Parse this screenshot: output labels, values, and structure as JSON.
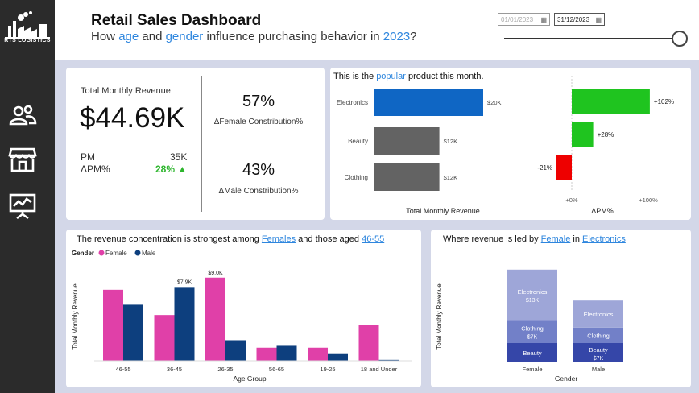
{
  "brand": {
    "logo_text": "RTS LOGISTICS"
  },
  "nav": [
    {
      "icon": "users-icon"
    },
    {
      "icon": "store-icon"
    },
    {
      "icon": "presentation-chart-icon"
    }
  ],
  "header": {
    "title": "Retail Sales Dashboard",
    "subtitle_parts": [
      "How ",
      "age",
      " and ",
      "gender",
      " influence purchasing behavior in ",
      "2023",
      "?"
    ],
    "date_start": "01/01/2023",
    "date_end": "31/12/2023"
  },
  "kpi": {
    "revenue_label": "Total Monthly Revenue",
    "revenue_value": "$44.69K",
    "pm_label": "PM",
    "pm_value": "35K",
    "dpm_label": "ΔPM%",
    "dpm_value": "28% ▲",
    "female_pct": "57%",
    "female_label": "ΔFemale Constribution%",
    "male_pct": "43%",
    "male_label": "ΔMale Constribution%"
  },
  "product": {
    "title_parts": [
      "This is the ",
      "popular",
      " product this month."
    ],
    "xlabel": "Total Monthly Revenue",
    "dpm_xlabel": "ΔPM%",
    "dpm_ticks": [
      "+0%",
      "+100%"
    ]
  },
  "age_card": {
    "title_parts": [
      "The revenue concentration is strongest among ",
      "Females",
      " and those aged ",
      "46-55"
    ],
    "legend_title": "Gender",
    "ylabel": "Total Monthly Revenue",
    "xlabel": "Age Group"
  },
  "gender_card": {
    "title_parts": [
      "Where revenue is led by ",
      "Female",
      " in ",
      "Electronics"
    ],
    "ylabel": "Total Monthly Revenue",
    "xlabel": "Gender"
  },
  "colors": {
    "female": "#e040a8",
    "male": "#0d3f7e",
    "electronics_bar": "#0f66c4",
    "grey_bar": "#636363",
    "positive": "#1fc41f",
    "negative": "#ee0000",
    "green_text": "#2db52d",
    "stack_electronics": "#9ea6d8",
    "stack_clothing": "#7280c8",
    "stack_beauty": "#3546a8"
  },
  "chart_data": [
    {
      "type": "bar",
      "orientation": "horizontal",
      "categories": [
        "Electronics",
        "Beauty",
        "Clothing"
      ],
      "values": [
        20,
        12,
        12
      ],
      "data_labels": [
        "$20K",
        "$12K",
        "$12K"
      ],
      "xlabel": "Total Monthly Revenue"
    },
    {
      "type": "bar",
      "orientation": "horizontal",
      "categories": [
        "Electronics",
        "Beauty",
        "Clothing"
      ],
      "values": [
        102,
        28,
        -21
      ],
      "data_labels": [
        "+102%",
        "+28%",
        "-21%"
      ],
      "xlabel": "ΔPM%",
      "xlim": [
        -30,
        110
      ]
    },
    {
      "type": "bar",
      "categories": [
        "46-55",
        "36-45",
        "26-35",
        "56-65",
        "19-25",
        "18 and Under"
      ],
      "series": [
        {
          "name": "Female",
          "values": [
            7.6,
            4.9,
            8.9,
            1.4,
            1.4,
            3.8
          ]
        },
        {
          "name": "Male",
          "values": [
            6.0,
            7.9,
            2.2,
            1.6,
            0.8,
            0.1
          ]
        }
      ],
      "data_labels": [
        {
          "category": "36-45",
          "series": "Male",
          "label": "$7.9K"
        },
        {
          "category": "26-35",
          "series": "Female",
          "label": "$9.0K"
        }
      ],
      "xlabel": "Age Group",
      "ylabel": "Total Monthly Revenue",
      "legend": "top-left",
      "ylim": [
        0,
        10
      ]
    },
    {
      "type": "bar",
      "stacked": true,
      "categories": [
        "Female",
        "Male"
      ],
      "series": [
        {
          "name": "Beauty",
          "values": [
            5,
            5
          ],
          "labels": [
            "Beauty",
            "Beauty $7K"
          ]
        },
        {
          "name": "Clothing",
          "values": [
            6,
            4
          ],
          "labels": [
            "Clothing $7K",
            "Clothing"
          ]
        },
        {
          "name": "Electronics",
          "values": [
            13,
            7
          ],
          "labels": [
            "Electronics $13K",
            "Electronics"
          ]
        }
      ],
      "xlabel": "Gender",
      "ylabel": "Total Monthly Revenue",
      "ylim": [
        0,
        26
      ]
    }
  ]
}
